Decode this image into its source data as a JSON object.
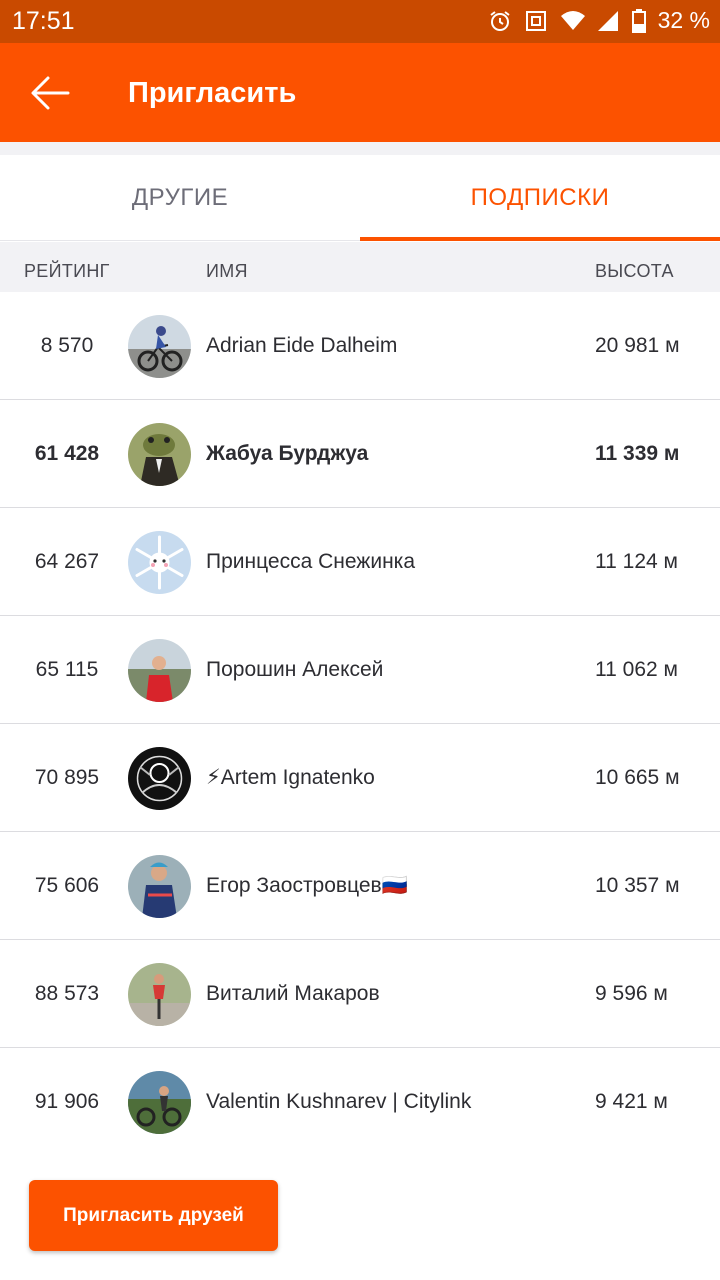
{
  "status_bar": {
    "time": "17:51",
    "battery": "32 %",
    "icons": [
      "alarm-icon",
      "nfc-icon",
      "wifi-icon",
      "signal-icon",
      "battery-icon"
    ]
  },
  "app_bar": {
    "title": "Пригласить",
    "back_icon": "arrow-left-icon",
    "color": "#fc5200"
  },
  "tabs": [
    {
      "label": "ДРУГИЕ",
      "active": false
    },
    {
      "label": "ПОДПИСКИ",
      "active": true
    }
  ],
  "table": {
    "headers": {
      "rank": "РЕЙТИНГ",
      "name": "ИМЯ",
      "height": "ВЫСОТА"
    },
    "rows": [
      {
        "rank": "8 570",
        "name": "Adrian Eide Dalheim",
        "height": "20 981 м",
        "me": false
      },
      {
        "rank": "61 428",
        "name": "Жабуа Бурджуа",
        "height": "11 339 м",
        "me": true
      },
      {
        "rank": "64 267",
        "name": "Принцесса Снежинка",
        "height": "11 124 м",
        "me": false
      },
      {
        "rank": "65 115",
        "name": "Порошин Алексей",
        "height": "11 062 м",
        "me": false
      },
      {
        "rank": "70 895",
        "name": "⚡Artem Ignatenko",
        "height": "10 665 м",
        "me": false
      },
      {
        "rank": "75 606",
        "name": "Егор Заостровцев🇷🇺",
        "height": "10 357 м",
        "me": false
      },
      {
        "rank": "88 573",
        "name": "Виталий Макаров",
        "height": "9 596 м",
        "me": false
      },
      {
        "rank": "91 906",
        "name": "Valentin Kushnarev | Citylink",
        "height": "9 421 м",
        "me": false
      }
    ]
  },
  "invite_button": {
    "label": "Пригласить друзей"
  },
  "colors": {
    "accent": "#fc5200",
    "status_bar": "#c94a00",
    "header_bg": "#f2f2f5"
  }
}
